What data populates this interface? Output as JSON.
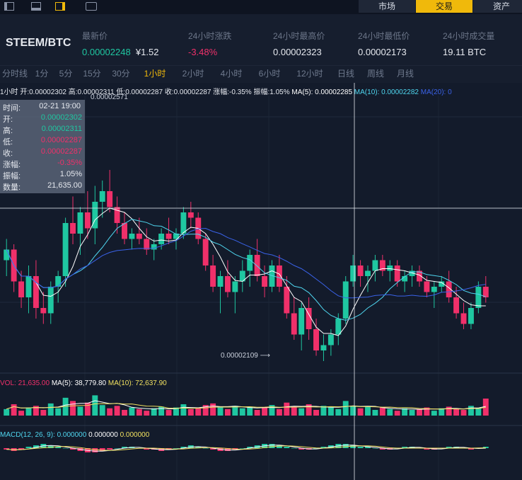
{
  "layout_buttons": [
    "layout-single-icon",
    "layout-bottom-icon",
    "layout-right-icon"
  ],
  "tabs": [
    "市场",
    "交易",
    "资产"
  ],
  "active_tab": 1,
  "pair": "STEEM/BTC",
  "stats": {
    "last_price_label": "最新价",
    "last_price": "0.00002248",
    "last_price_cny": "¥1.52",
    "change_label": "24小时涨跌",
    "change": "-3.48%",
    "high_label": "24小时最高价",
    "high": "0.00002323",
    "low_label": "24小时最低价",
    "low": "0.00002173",
    "volume_label": "24小时成交量",
    "volume": "19.11 BTC"
  },
  "intervals": [
    "分时线",
    "1分",
    "5分",
    "15分",
    "30分",
    "1小时",
    "2小时",
    "4小时",
    "6小时",
    "12小时",
    "日线",
    "周线",
    "月线"
  ],
  "active_interval": 5,
  "info_line": {
    "period": "1小时",
    "open_label": "开:",
    "open": "0.00002302",
    "high_label": "高:",
    "high": "0.00002311",
    "low_label": "低:",
    "low": "0.00002287",
    "close_label": "收:",
    "close": "0.00002287",
    "change_label": "涨幅:",
    "change": "-0.35%",
    "amplitude_label": "振幅:",
    "amplitude": "1.05%",
    "ma5": "MA(5): 0.00002285",
    "ma10": "MA(10): 0.00002282",
    "ma20": "MA(20): 0"
  },
  "tooltip": {
    "time_label": "时间:",
    "time": "02-21 19:00",
    "open_label": "开:",
    "open": "0.00002302",
    "high_label": "高:",
    "high": "0.00002311",
    "low_label": "低:",
    "low": "0.00002287",
    "close_label": "收:",
    "close": "0.00002287",
    "change_label": "涨幅:",
    "change": "-0.35%",
    "amplitude_label": "振幅:",
    "amplitude": "1.05%",
    "volume_label": "数量:",
    "volume": "21,635.00"
  },
  "max_label": "0.00002571",
  "min_label": "0.00002109",
  "vol_line": {
    "vol": "VOL: 21,635.00",
    "ma5": "MA(5): 38,779.80",
    "ma10": "MA(10): 72,637.90"
  },
  "macd_line": {
    "name": "MACD(12, 26, 9): 0.000000",
    "v2": "0.000000",
    "v3": "0.000000"
  },
  "colors": {
    "up": "#1fc7a1",
    "down": "#f0306a",
    "accent": "#f0b90b",
    "ma5": "#ffffff",
    "ma10": "#4fd6ef",
    "ma20": "#3a62e8"
  },
  "chart_data": {
    "type": "candlestick",
    "price_ylim": [
      2.09e-05,
      2.61e-05
    ],
    "candles": [
      [
        2300,
        2340,
        2270,
        2320
      ],
      [
        2320,
        2330,
        2240,
        2260
      ],
      [
        2260,
        2280,
        2210,
        2230
      ],
      [
        2230,
        2290,
        2200,
        2270
      ],
      [
        2270,
        2300,
        2190,
        2210
      ],
      [
        2210,
        2240,
        2180,
        2200
      ],
      [
        2200,
        2260,
        2180,
        2250
      ],
      [
        2250,
        2280,
        2220,
        2270
      ],
      [
        2270,
        2380,
        2250,
        2370
      ],
      [
        2370,
        2420,
        2330,
        2350
      ],
      [
        2350,
        2400,
        2310,
        2390
      ],
      [
        2390,
        2430,
        2340,
        2360
      ],
      [
        2360,
        2440,
        2330,
        2410
      ],
      [
        2410,
        2450,
        2380,
        2430
      ],
      [
        2430,
        2470,
        2390,
        2400
      ],
      [
        2400,
        2420,
        2350,
        2370
      ],
      [
        2370,
        2390,
        2330,
        2340
      ],
      [
        2340,
        2360,
        2320,
        2350
      ],
      [
        2350,
        2380,
        2330,
        2340
      ],
      [
        2340,
        2360,
        2310,
        2320
      ],
      [
        2320,
        2340,
        2300,
        2330
      ],
      [
        2330,
        2360,
        2320,
        2350
      ],
      [
        2350,
        2380,
        2330,
        2340
      ],
      [
        2340,
        2360,
        2320,
        2350
      ],
      [
        2350,
        2400,
        2340,
        2390
      ],
      [
        2390,
        2410,
        2360,
        2380
      ],
      [
        2380,
        2390,
        2330,
        2340
      ],
      [
        2340,
        2350,
        2280,
        2290
      ],
      [
        2290,
        2310,
        2240,
        2250
      ],
      [
        2250,
        2280,
        2200,
        2270
      ],
      [
        2270,
        2300,
        2230,
        2240
      ],
      [
        2240,
        2270,
        2200,
        2260
      ],
      [
        2260,
        2300,
        2240,
        2280
      ],
      [
        2280,
        2320,
        2250,
        2310
      ],
      [
        2310,
        2340,
        2260,
        2270
      ],
      [
        2270,
        2290,
        2230,
        2250
      ],
      [
        2250,
        2300,
        2240,
        2290
      ],
      [
        2290,
        2310,
        2240,
        2250
      ],
      [
        2250,
        2270,
        2190,
        2200
      ],
      [
        2200,
        2230,
        2150,
        2160
      ],
      [
        2160,
        2220,
        2130,
        2210
      ],
      [
        2210,
        2230,
        2150,
        2170
      ],
      [
        2170,
        2190,
        2120,
        2130
      ],
      [
        2130,
        2160,
        2110,
        2140
      ],
      [
        2140,
        2170,
        2120,
        2160
      ],
      [
        2160,
        2200,
        2140,
        2190
      ],
      [
        2190,
        2270,
        2180,
        2260
      ],
      [
        2260,
        2310,
        2250,
        2290
      ],
      [
        2290,
        2300,
        2250,
        2270
      ],
      [
        2270,
        2290,
        2240,
        2280
      ],
      [
        2280,
        2310,
        2260,
        2300
      ],
      [
        2300,
        2310,
        2270,
        2280
      ],
      [
        2280,
        2300,
        2260,
        2290
      ],
      [
        2290,
        2300,
        2250,
        2260
      ],
      [
        2260,
        2280,
        2240,
        2270
      ],
      [
        2270,
        2290,
        2250,
        2280
      ],
      [
        2280,
        2290,
        2250,
        2260
      ],
      [
        2260,
        2270,
        2230,
        2240
      ],
      [
        2240,
        2260,
        2210,
        2250
      ],
      [
        2250,
        2270,
        2240,
        2260
      ],
      [
        2260,
        2280,
        2220,
        2230
      ],
      [
        2230,
        2250,
        2190,
        2200
      ],
      [
        2200,
        2220,
        2170,
        2180
      ],
      [
        2180,
        2220,
        2170,
        2210
      ],
      [
        2210,
        2260,
        2200,
        2250
      ],
      [
        2250,
        2270,
        2220,
        2230
      ]
    ],
    "volumes": [
      8,
      14,
      6,
      10,
      12,
      7,
      15,
      9,
      22,
      18,
      11,
      16,
      25,
      13,
      9,
      12,
      7,
      10,
      8,
      6,
      9,
      11,
      7,
      10,
      14,
      8,
      9,
      13,
      15,
      10,
      8,
      12,
      9,
      11,
      7,
      10,
      13,
      8,
      16,
      11,
      9,
      14,
      7,
      12,
      10,
      8,
      18,
      12,
      9,
      11,
      7,
      10,
      8,
      6,
      9,
      7,
      8,
      10,
      6,
      9,
      11,
      8,
      7,
      12,
      9,
      21
    ],
    "macd": [
      -1,
      -2,
      -1,
      1,
      2,
      3,
      2,
      1,
      0,
      -1,
      -2,
      -3,
      -3,
      -2,
      -1,
      0,
      1,
      1,
      0,
      -1,
      -1,
      -2,
      -1,
      0,
      1,
      2,
      1,
      0,
      -1,
      -2,
      -2,
      -1,
      0,
      1,
      2,
      3,
      3,
      2,
      1,
      0,
      -1,
      -1,
      0,
      1,
      2,
      3,
      3,
      2,
      1,
      1,
      0,
      -1,
      -1,
      0,
      1,
      1,
      0,
      -1,
      -1,
      0,
      1,
      1,
      0,
      -1,
      0,
      1
    ]
  }
}
